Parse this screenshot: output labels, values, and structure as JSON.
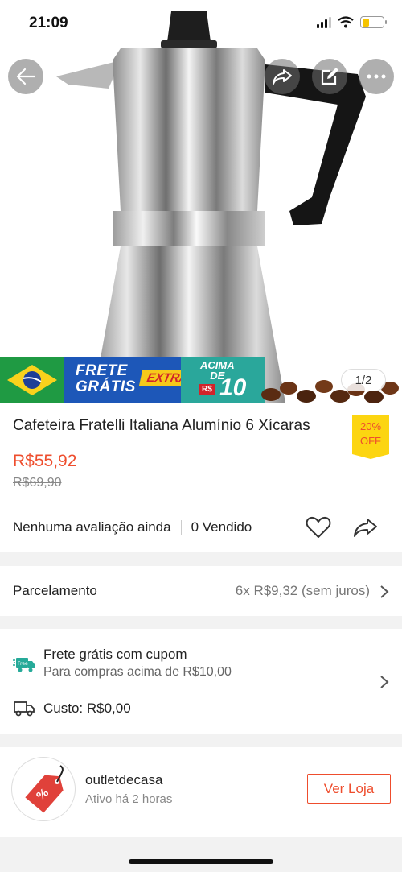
{
  "status_bar": {
    "time": "21:09"
  },
  "gallery": {
    "counter": "1/2",
    "promo": {
      "frete": "FRETE",
      "gratis": "GRÁTIS",
      "extra": "EXTRA",
      "acima": "ACIMA",
      "de": "DE",
      "currency": "R$",
      "amount": "10"
    }
  },
  "product": {
    "title": "Cafeteira Fratelli Italiana Alumínio 6 Xícaras",
    "discount_percent": "20%",
    "discount_label": "OFF",
    "price": "R$55,92",
    "original_price": "R$69,90",
    "rating_text": "Nenhuma avaliação ainda",
    "sold_text": "0 Vendido"
  },
  "installments": {
    "label": "Parcelamento",
    "value": "6x R$9,32 (sem juros)"
  },
  "shipping": {
    "badge": "Free",
    "title": "Frete grátis com cupom",
    "subtitle": "Para compras acima de R$10,00",
    "cost": "Custo: R$0,00"
  },
  "shop": {
    "name": "outletdecasa",
    "status": "Ativo há 2 horas",
    "visit_label": "Ver Loja"
  },
  "colors": {
    "accent": "#ee4d2d",
    "discount_bg": "#fcd511",
    "shipping_icon": "#26aa99"
  }
}
